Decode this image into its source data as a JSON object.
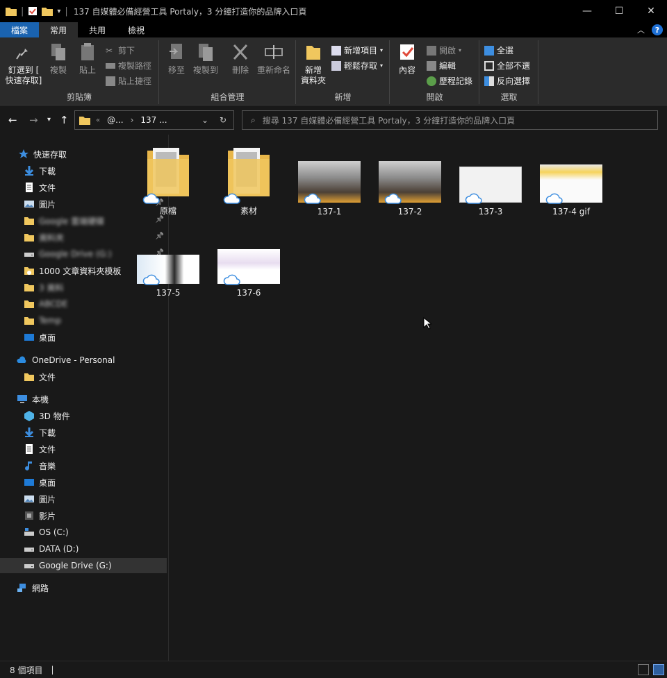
{
  "window": {
    "title": "137 自媒體必備經營工具 Portaly，3 分鐘打造你的品牌入口頁",
    "controls": [
      "minimize",
      "maximize",
      "close"
    ]
  },
  "ribbon_tabs": [
    "檔案",
    "常用",
    "共用",
    "檢視"
  ],
  "ribbon": {
    "clipboard": {
      "label": "剪貼簿",
      "pin": "釘選到 [\n快速存取]",
      "copy": "複製",
      "paste": "貼上",
      "cut": "剪下",
      "copy_path": "複製路徑",
      "paste_shortcut": "貼上捷徑"
    },
    "organize": {
      "label": "組合管理",
      "move_to": "移至",
      "copy_to": "複製到",
      "delete": "刪除",
      "rename": "重新命名"
    },
    "new": {
      "label": "新增",
      "new_folder": "新增\n資料夾",
      "new_item": "新增項目",
      "easy_access": "輕鬆存取"
    },
    "open": {
      "label": "開啟",
      "properties": "內容",
      "open": "開啟",
      "edit": "編輯",
      "history": "歷程記錄"
    },
    "select": {
      "label": "選取",
      "select_all": "全選",
      "select_none": "全部不選",
      "invert": "反向選擇"
    }
  },
  "address": {
    "crumb_prefix": "«",
    "crumb1": "@...",
    "crumb2": "137 ...",
    "search_placeholder": "搜尋 137 自媒體必備經營工具 Portaly，3 分鐘打造你的品牌入口頁"
  },
  "sidebar": {
    "quick_access": "快速存取",
    "quick_items": [
      {
        "label": "下載",
        "icon": "download-icon",
        "pinned": true
      },
      {
        "label": "文件",
        "icon": "document-icon",
        "pinned": true
      },
      {
        "label": "圖片",
        "icon": "pictures-icon",
        "pinned": true
      },
      {
        "label": "Google 雲端硬碟",
        "icon": "folder-icon",
        "pinned": true,
        "blurred": true
      },
      {
        "label": "資料夾",
        "icon": "folder-icon",
        "pinned": true,
        "blurred": true
      },
      {
        "label": "Google Drive (G:)",
        "icon": "drive-icon",
        "pinned": true,
        "blurred": true
      },
      {
        "label": "1000 文章資料夾模板",
        "icon": "folder-cloud-icon",
        "pinned": true
      },
      {
        "label": "3 資料",
        "icon": "folder-icon",
        "pinned": false,
        "blurred": true
      },
      {
        "label": "ABCDE",
        "icon": "folder-icon",
        "pinned": false,
        "blurred": true
      },
      {
        "label": "Temp",
        "icon": "folder-icon",
        "pinned": false,
        "blurred": true
      },
      {
        "label": "桌面",
        "icon": "desktop-icon",
        "pinned": false
      }
    ],
    "onedrive": "OneDrive - Personal",
    "onedrive_items": [
      {
        "label": "文件",
        "icon": "folder-icon"
      }
    ],
    "this_pc": "本機",
    "pc_items": [
      {
        "label": "3D 物件",
        "icon": "3d-objects-icon"
      },
      {
        "label": "下載",
        "icon": "download-icon"
      },
      {
        "label": "文件",
        "icon": "document-icon"
      },
      {
        "label": "音樂",
        "icon": "music-icon"
      },
      {
        "label": "桌面",
        "icon": "desktop-icon"
      },
      {
        "label": "圖片",
        "icon": "pictures-icon"
      },
      {
        "label": "影片",
        "icon": "videos-icon"
      },
      {
        "label": "OS (C:)",
        "icon": "os-drive-icon"
      },
      {
        "label": "DATA (D:)",
        "icon": "drive-icon"
      },
      {
        "label": "Google Drive (G:)",
        "icon": "drive-icon",
        "selected": true
      }
    ],
    "network": "網路"
  },
  "files": [
    {
      "name": "原檔",
      "kind": "folder"
    },
    {
      "name": "素材",
      "kind": "folder"
    },
    {
      "name": "137-1",
      "kind": "photo-dark"
    },
    {
      "name": "137-2",
      "kind": "photo-dark"
    },
    {
      "name": "137-3",
      "kind": "doc-white"
    },
    {
      "name": "137-4 gif",
      "kind": "doc-yellow"
    },
    {
      "name": "137-5",
      "kind": "doc-mixed"
    },
    {
      "name": "137-6",
      "kind": "doc-pricing"
    }
  ],
  "status": {
    "count": "8 個項目",
    "separator": "|"
  },
  "colors": {
    "accent": "#1a63b0",
    "folder": "#f0c75e",
    "background": "#191919",
    "ribbon": "#2b2b2b"
  }
}
